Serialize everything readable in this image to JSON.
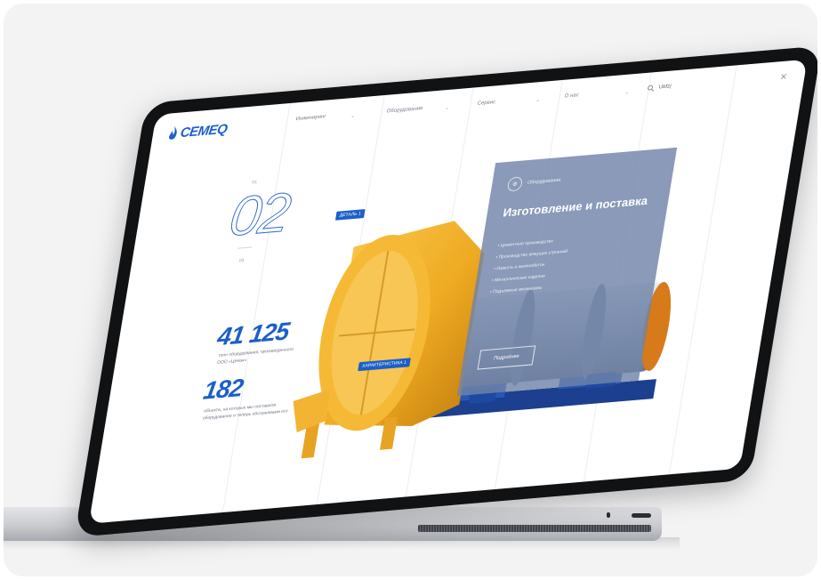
{
  "brand": {
    "name": "CEMEQ",
    "color": "#1b5fc9"
  },
  "nav": {
    "items": [
      {
        "label": "Инжиниринг"
      },
      {
        "label": "Оборудование"
      },
      {
        "label": "Сервис"
      },
      {
        "label": "О нас"
      }
    ]
  },
  "search": {
    "value": "Ubfz|"
  },
  "icons": {
    "logo": "flame-logo-icon",
    "chevron": "chevron-down-icon",
    "search": "search-icon",
    "close": "close-icon"
  },
  "hero": {
    "number": "02",
    "small_top": "01",
    "small_bottom": "03"
  },
  "stats": [
    {
      "value": "41 125",
      "text": "тонн оборудования, произведенного ООО «Цемэк»"
    },
    {
      "value": "182",
      "text": "объекта, на которых мы поставили оборудование и теперь обслуживаем его"
    }
  ],
  "tags": {
    "detail": "ДЕТАЛЬ 1",
    "spec": "ХАРАКТЕРИСТИКА 1"
  },
  "panel": {
    "badge": "Оборудование",
    "title": "Изготовление и поставка",
    "items": [
      "Цементное производство",
      "Производство вяжущих строений",
      "Известь и железобетон",
      "Металлические изделия",
      "Подъемные механизмы"
    ],
    "button": "Подробнее"
  }
}
